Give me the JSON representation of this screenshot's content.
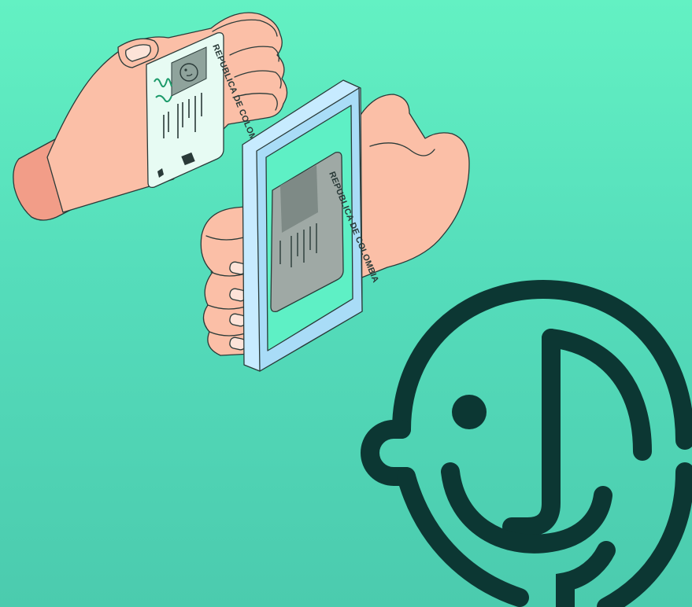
{
  "illustration": {
    "id_card_heading": "REPUBLICA DE COLOMBIA",
    "phone_card_heading": "REPUBLICA DE COLOMBIA"
  },
  "icons": {
    "hand_left": "hand-holding-card-icon",
    "hand_right": "hand-holding-phone-icon",
    "card": "id-card-icon",
    "phone": "smartphone-icon",
    "face_scan": "face-recognition-icon"
  },
  "colors": {
    "background_top": "#63f1c3",
    "background_bottom": "#4bcbae",
    "skin": "#fbbfa7",
    "skin_shadow": "#f29d88",
    "card": "#e7fbf3",
    "phone_frame": "#a9dcf7",
    "phone_screen": "#5ef0c5",
    "face_icon": "#0c3733"
  }
}
